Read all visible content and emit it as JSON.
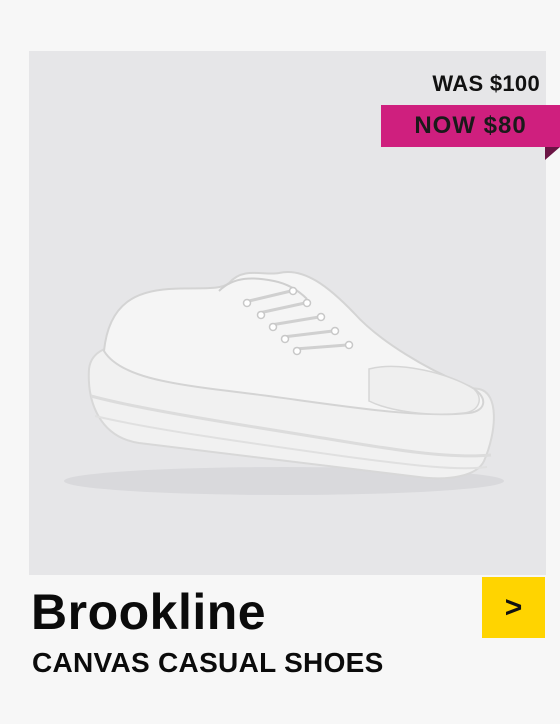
{
  "promo": {
    "was_price": "WAS $100",
    "now_price": "NOW $80"
  },
  "product": {
    "name": "Brookline",
    "category": "CANVAS CASUAL SHOES",
    "image_alt": "white canvas low-top sneaker"
  },
  "cta": {
    "label": ">",
    "icon": "chevron-right-icon"
  },
  "colors": {
    "badge": "#cf1f7e",
    "cta": "#ffd400",
    "photo_bg": "#e6e6e8"
  }
}
